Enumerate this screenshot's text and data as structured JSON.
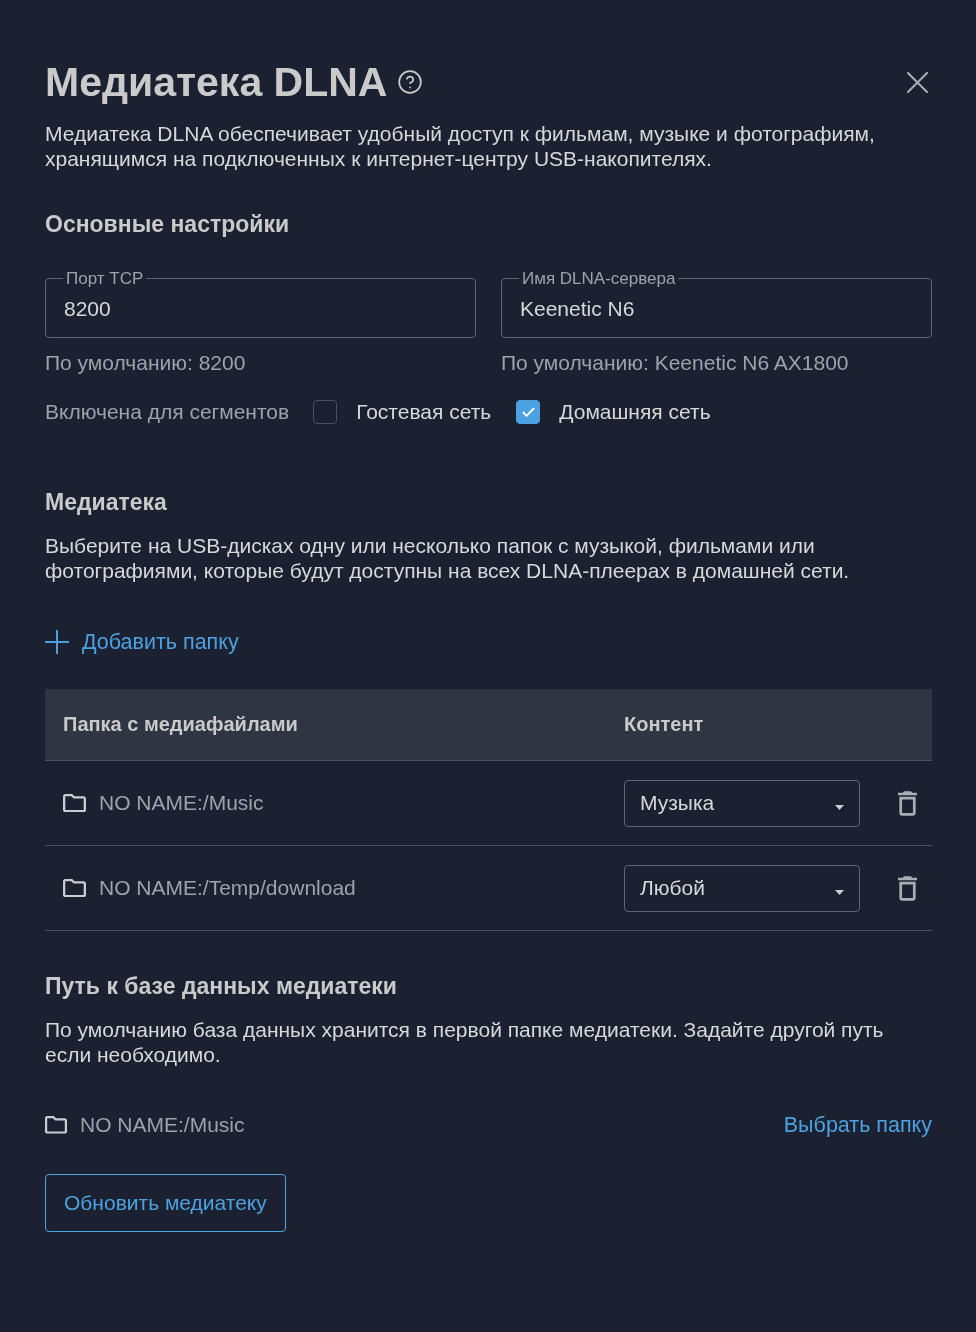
{
  "dialog": {
    "title": "Медиатека DLNA",
    "description": "Медиатека DLNA обеспечивает удобный доступ к фильмам, музыке и фотографиям, хранящимся на подключенных к интернет-центру USB-накопителях."
  },
  "basic_settings": {
    "heading": "Основные настройки",
    "fields": [
      {
        "label": "Порт TCP",
        "value": "8200",
        "hint": "По умолчанию: 8200"
      },
      {
        "label": "Имя DLNA-сервера",
        "value": "Keenetic N6",
        "hint": "По умолчанию: Keenetic N6 AX1800"
      }
    ],
    "segments": {
      "label": "Включена для сегментов",
      "options": [
        {
          "label": "Гостевая сеть",
          "checked": false
        },
        {
          "label": "Домашняя сеть",
          "checked": true
        }
      ]
    }
  },
  "media_library": {
    "heading": "Медиатека",
    "description": "Выберите на USB-дисках одну или несколько папок с музыкой, фильмами или фотографиями, которые будут доступны на всех DLNA-плеерах в домашней сети.",
    "add_folder": "Добавить папку",
    "table": {
      "columns": [
        "Папка с медиафайлами",
        "Контент"
      ],
      "rows": [
        {
          "folder": "NO NAME:/Music",
          "content": "Музыка"
        },
        {
          "folder": "NO NAME:/Temp/download",
          "content": "Любой"
        }
      ]
    }
  },
  "database_path": {
    "heading": "Путь к базе данных медиатеки",
    "description": "По умолчанию база данных хранится в первой папке медиатеки. Задайте другой путь если необходимо.",
    "path": "NO NAME:/Music",
    "choose_link": "Выбрать папку"
  },
  "refresh_button": "Обновить медиатеку"
}
